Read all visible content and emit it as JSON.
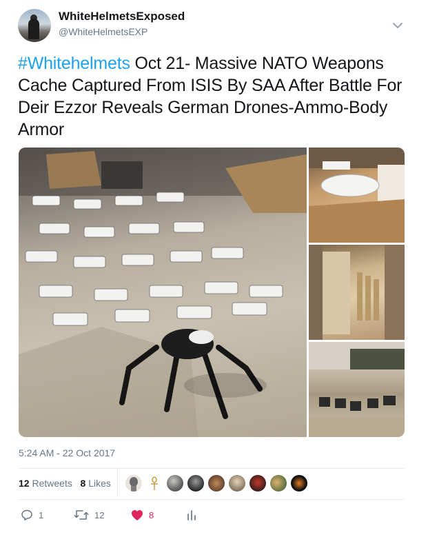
{
  "user": {
    "display_name": "WhiteHelmetsExposed",
    "handle": "@WhiteHelmetsEXP"
  },
  "tweet": {
    "hashtag": "#Whitehelmets",
    "text": " Oct 21- Massive NATO Weapons Cache Captured From ISIS By SAA After Battle For Deir Ezzor Reveals German Drones-Ammo-Body Armor",
    "timestamp": "5:24 AM - 22 Oct 2017"
  },
  "stats": {
    "retweets_count": "12",
    "retweets_label": "Retweets",
    "likes_count": "8",
    "likes_label": "Likes"
  },
  "actions": {
    "reply_count": "1",
    "retweet_count": "12",
    "like_count": "8"
  },
  "colors": {
    "accent": "#1da1f2",
    "like": "#e0245e",
    "muted": "#657786"
  },
  "icons": {
    "menu": "chevron-down-icon",
    "reply": "reply-icon",
    "retweet": "retweet-icon",
    "like": "heart-icon",
    "activity": "analytics-icon"
  }
}
